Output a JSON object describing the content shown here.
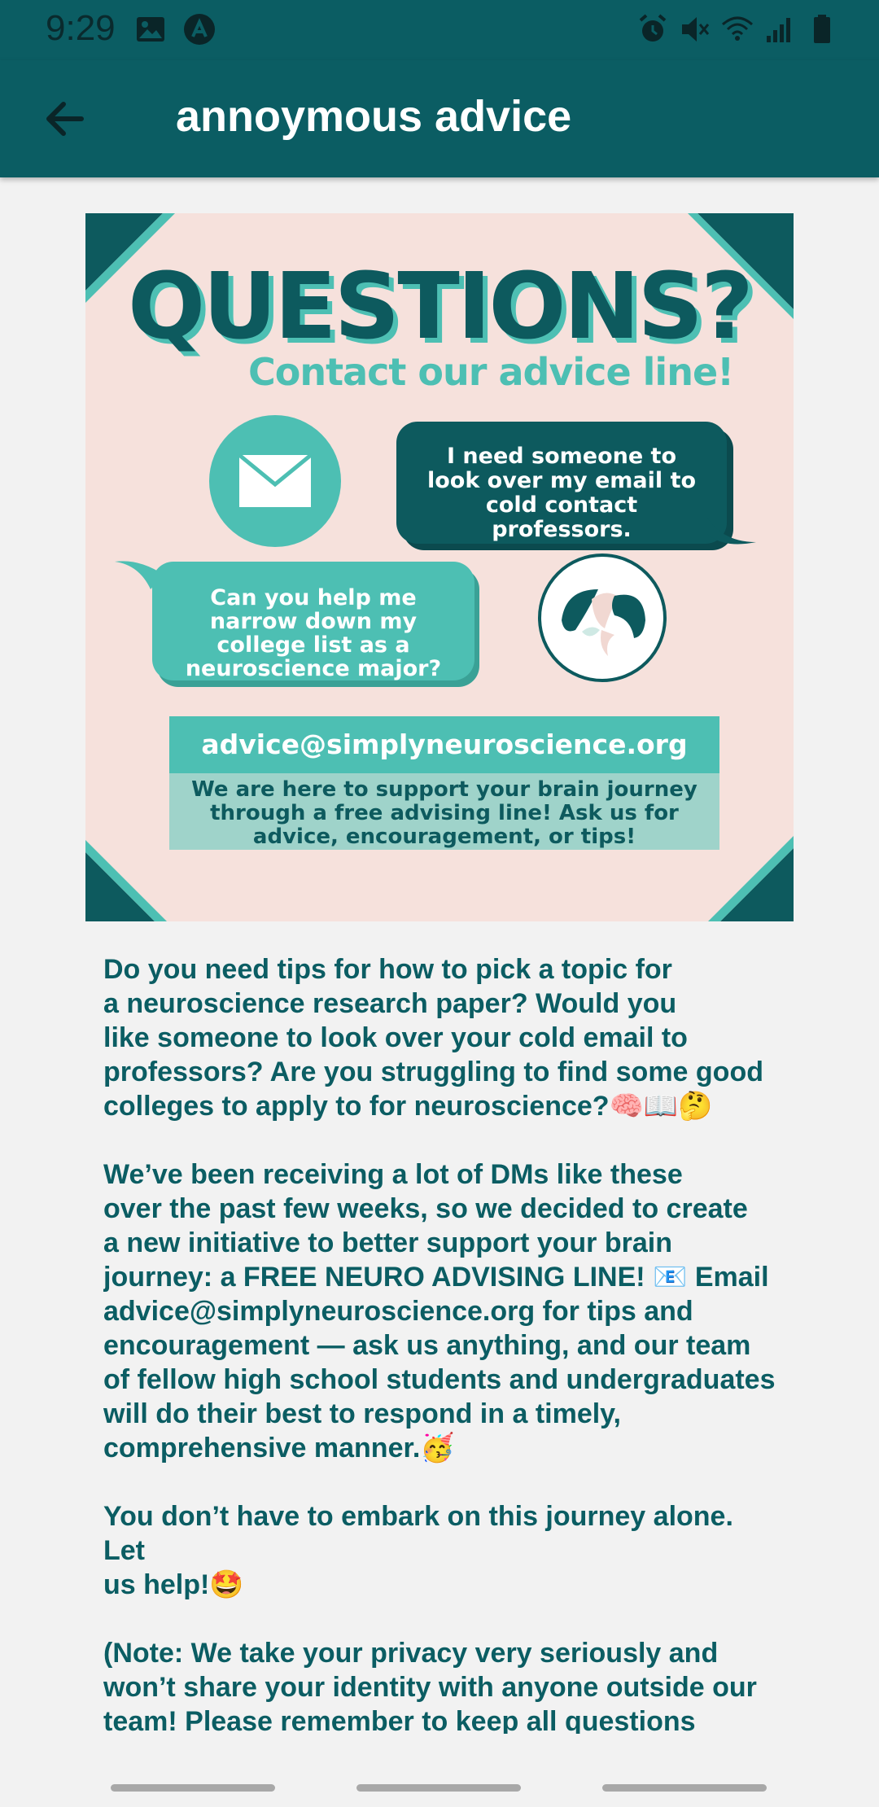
{
  "status_bar": {
    "time": "9:29",
    "left_icons": [
      "image-icon",
      "app-notification-icon"
    ],
    "right_icons": [
      "alarm-icon",
      "vibrate-off-icon",
      "wifi-icon",
      "signal-icon",
      "battery-icon"
    ]
  },
  "app_bar": {
    "title": "annoymous advice",
    "back_icon": "arrow-left-icon"
  },
  "poster": {
    "title": "QUESTIONS?",
    "subtitle": "Contact our advice line!",
    "bubble_dark_text": "I need someone to look over my email to cold contact professors.",
    "bubble_light_text": "Can you help me narrow down my college list as a neuroscience major?",
    "email": "advice@simplyneuroscience.org",
    "support_text": "We are here to support your brain journey through a free advising line! Ask us for advice, encouragement, or tips!",
    "colors": {
      "background": "#f6e1dc",
      "dark_teal": "#0d5a5e",
      "teal": "#4dbfb3",
      "light_teal": "#9fd3ca"
    }
  },
  "body": {
    "paragraphs": [
      "Do you need tips for how to pick a topic for\na neuroscience research paper? Would you\nlike someone to look over your cold email to\nprofessors? Are you struggling to find some good\ncolleges to apply to for neuroscience?🧠📖🤔",
      "We’ve been receiving a lot of DMs like these\nover the past few weeks, so we decided to create\na new initiative to better support your brain\njourney: a FREE NEURO ADVISING LINE! 📧 Email\nadvice@simplyneuroscience.org for tips and\nencouragement — ask us anything, and our team\nof fellow high school students and undergraduates\nwill do their best to respond in a timely,\ncomprehensive manner.🥳",
      "You don’t have to embark on this journey alone. Let\nus help!🤩",
      "(Note: We take your privacy very seriously and\nwon’t share your identity with anyone outside our\nteam! Please remember to keep all questions\nappropriate.)"
    ]
  },
  "colors": {
    "app_bar": "#0b5d63",
    "background": "#f2f2f2",
    "text": "#0b5d63"
  }
}
